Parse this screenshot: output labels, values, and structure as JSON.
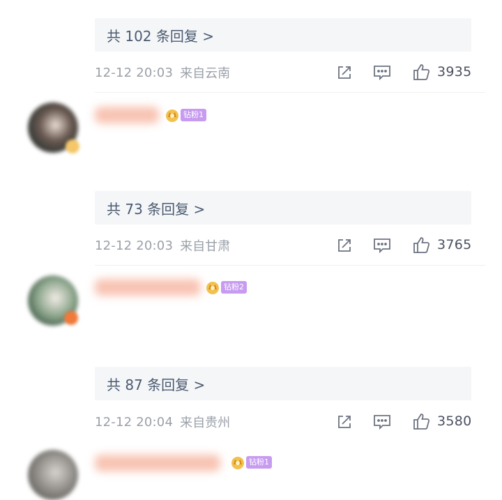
{
  "comments": [
    {
      "reply_label": "共 102 条回复 >",
      "time": "12-12 20:03",
      "location": "来自云南",
      "likes": "3935",
      "next_fan_badge": "钻粉1",
      "avatar_color": "#3a3f3c"
    },
    {
      "reply_label": "共 73 条回复 >",
      "time": "12-12 20:03",
      "location": "来自甘肃",
      "likes": "3765",
      "next_fan_badge": "钻粉2",
      "avatar_color": "#5a7a5e"
    },
    {
      "reply_label": "共 87 条回复 >",
      "time": "12-12 20:04",
      "location": "来自贵州",
      "likes": "3580",
      "next_fan_badge": "钻粉1",
      "avatar_color": "#8a8a86"
    }
  ],
  "icons": {
    "share": "share-icon",
    "comment": "comment-icon",
    "like": "like-icon",
    "crown": "crown-icon"
  }
}
